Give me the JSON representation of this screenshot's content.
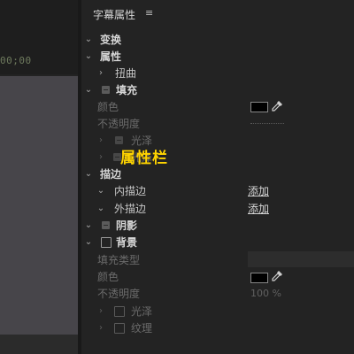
{
  "left_pane": {
    "timecode": "00;00"
  },
  "panel": {
    "title": "字幕属性",
    "menu_icon": "hamburger-menu-icon"
  },
  "tree": {
    "transform": "变换",
    "properties": "属性",
    "distort": "扭曲",
    "fill": "填充",
    "fill_color": "颜色",
    "fill_opacity": "不透明度",
    "fill_sheen": "光泽",
    "fill_texture_hidden": "光泽",
    "strokes": "描边",
    "inner_stroke": "内描边",
    "outer_stroke": "外描边",
    "shadow": "阴影",
    "background": "背景",
    "bg_fill_type": "填充类型",
    "bg_color": "颜色",
    "bg_opacity": "不透明度",
    "bg_sheen": "光泽",
    "bg_texture": "纹理"
  },
  "values": {
    "add_inner": "添加",
    "add_outer": "添加",
    "bg_opacity_value": "100 %",
    "fill_color_hex": "#000000",
    "bg_color_hex": "#000000"
  },
  "overlay": {
    "label": "属性栏"
  }
}
